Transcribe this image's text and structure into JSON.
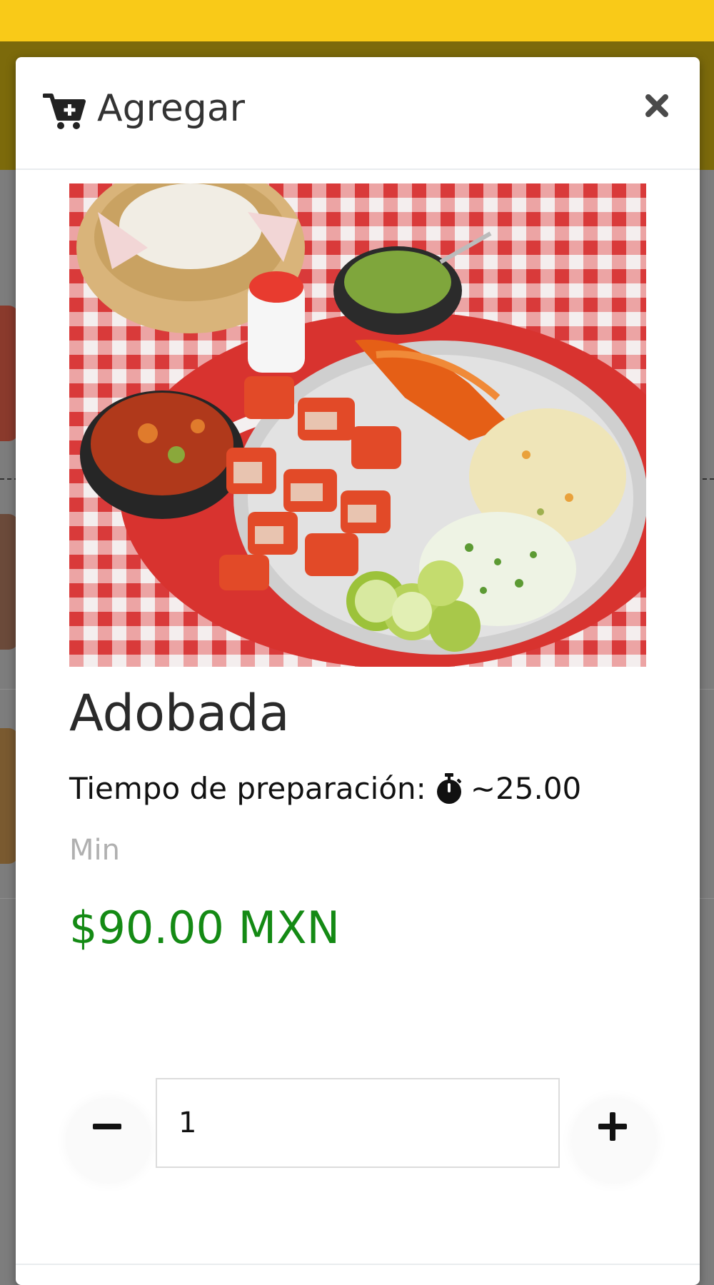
{
  "modal": {
    "title": "Agregar",
    "close_icon": "close-icon",
    "cart_icon": "cart-plus-icon"
  },
  "product": {
    "image_description": "plate of adobada pork with rice, lime, onion, salsas and tortillas",
    "name": "Adobada",
    "prep_label": "Tiempo de preparación:",
    "prep_value": "~25.00",
    "prep_unit": "Min",
    "timer_icon": "stopwatch-icon",
    "price": "$90.00 MXN"
  },
  "quantity": {
    "value": "1",
    "minus_icon": "minus-icon",
    "plus_icon": "plus-icon"
  },
  "colors": {
    "topbar": "#f9ca18",
    "price": "#148a14"
  }
}
